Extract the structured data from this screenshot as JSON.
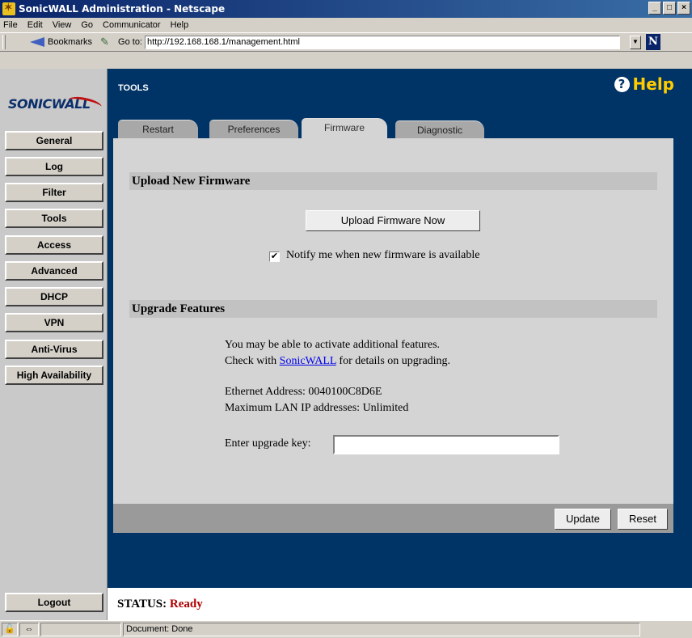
{
  "window": {
    "title": "SonicWALL Administration - Netscape",
    "min": "_",
    "max": "□",
    "close": "×"
  },
  "menu": [
    "File",
    "Edit",
    "View",
    "Go",
    "Communicator",
    "Help"
  ],
  "location": {
    "bookmarks": "Bookmarks",
    "goto_label": "Go to:",
    "url": "http://192.168.168.1/management.html",
    "netscape_logo": "N"
  },
  "sidebar": {
    "logo": "SONICWALL",
    "items": [
      "General",
      "Log",
      "Filter",
      "Tools",
      "Access",
      "Advanced",
      "DHCP",
      "VPN",
      "Anti-Virus",
      "High Availability"
    ],
    "logout": "Logout"
  },
  "header": {
    "section": "TOOLS",
    "help": "Help"
  },
  "tabs": [
    "Restart",
    "Preferences",
    "Firmware",
    "Diagnostic"
  ],
  "active_tab": "Firmware",
  "firmware": {
    "heading": "Upload New Firmware",
    "upload_button": "Upload Firmware Now",
    "notify_label": "Notify me when new firmware is available",
    "notify_checked": true
  },
  "upgrade": {
    "heading": "Upgrade Features",
    "line1": "You may be able to activate additional features.",
    "line2_prefix": "Check with ",
    "line2_link": "SonicWALL",
    "line2_suffix": " for details on upgrading.",
    "ethernet": "Ethernet Address: 0040100C8D6E",
    "max_lan": "Maximum LAN IP addresses: Unlimited",
    "key_label": "Enter upgrade key:",
    "key_value": ""
  },
  "actions": {
    "update": "Update",
    "reset": "Reset"
  },
  "status": {
    "label": "STATUS:",
    "value": "Ready"
  },
  "statusbar": {
    "text": "Document: Done"
  },
  "colors": {
    "navy": "#003466",
    "help_yellow": "#ffcc00",
    "status_red": "#b00000",
    "link_blue": "#0000ee"
  }
}
